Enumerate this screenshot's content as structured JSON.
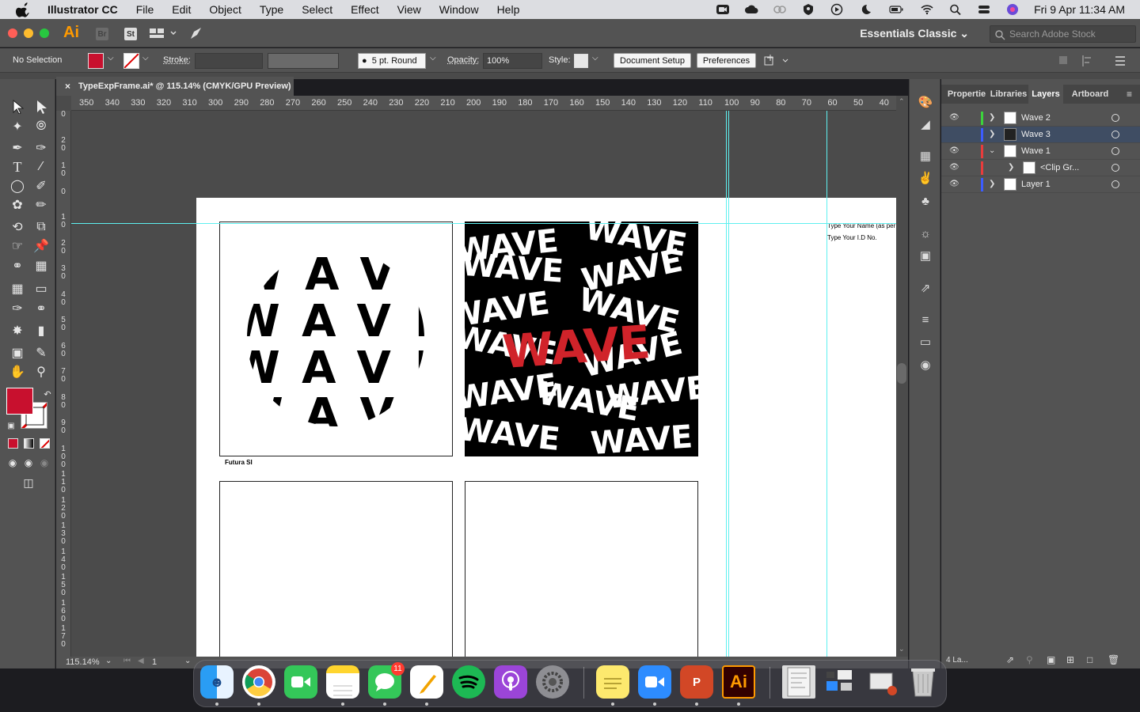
{
  "menubar": {
    "app_name": "Illustrator CC",
    "items": [
      "File",
      "Edit",
      "Object",
      "Type",
      "Select",
      "Effect",
      "View",
      "Window",
      "Help"
    ],
    "clock": "Fri 9 Apr  11:34 AM"
  },
  "appbar": {
    "logo": "Ai",
    "bridge": "Br",
    "stock_app": "St",
    "workspace": "Essentials Classic",
    "search_placeholder": "Search Adobe Stock"
  },
  "control": {
    "selection": "No Selection",
    "stroke_label": "Stroke:",
    "brush": "5 pt. Round",
    "opacity_label": "Opacity:",
    "opacity": "100%",
    "style_label": "Style:",
    "document_setup": "Document Setup",
    "preferences": "Preferences",
    "fill_color": "#c8102e"
  },
  "document": {
    "tab_title": "TypeExpFrame.ai* @ 115.14% (CMYK/GPU Preview)",
    "zoom": "115.14%",
    "artboard_num": "1"
  },
  "ruler": {
    "h_ticks": [
      "350",
      "340",
      "330",
      "320",
      "310",
      "300",
      "290",
      "280",
      "270",
      "260",
      "250",
      "240",
      "230",
      "220",
      "210",
      "200",
      "190",
      "180",
      "170",
      "160",
      "150",
      "140",
      "130",
      "120",
      "110",
      "100",
      "90",
      "80",
      "70",
      "60",
      "50",
      "40"
    ],
    "v_ticks": [
      "0",
      "20",
      "10",
      "0",
      "10",
      "20",
      "30",
      "40",
      "50",
      "60",
      "70",
      "80",
      "90",
      "100",
      "110",
      "120",
      "130",
      "140",
      "150",
      "160",
      "170"
    ]
  },
  "artwork": {
    "wave_word": "WAVE",
    "caption": "Futura SI",
    "name_text": "Type Your Name (as per",
    "id_text": "Type Your I.D No.",
    "accent": "#d0232a"
  },
  "panel": {
    "tabs": [
      "Propertie",
      "Libraries",
      "Layers",
      "Artboard"
    ],
    "active_tab": "Layers",
    "layers": [
      {
        "name": "Wave 2",
        "color": "#3cd33c"
      },
      {
        "name": "Wave 3",
        "color": "#3c5cff"
      },
      {
        "name": "Wave 1",
        "color": "#e83c3c"
      },
      {
        "name": "<Clip Gr...",
        "color": "#e83c3c"
      },
      {
        "name": "Layer 1",
        "color": "#3c5cff"
      }
    ],
    "footer": "4 La..."
  },
  "dock": {
    "messages_badge": "11",
    "apps": [
      "Finder",
      "Chrome",
      "FaceTime",
      "Notes",
      "Messages",
      "Pages",
      "Spotify",
      "Podcasts",
      "System Preferences",
      "Stickies",
      "Zoom",
      "PowerPoint",
      "Illustrator",
      "Preview",
      "Mission Control",
      "Trash"
    ]
  }
}
